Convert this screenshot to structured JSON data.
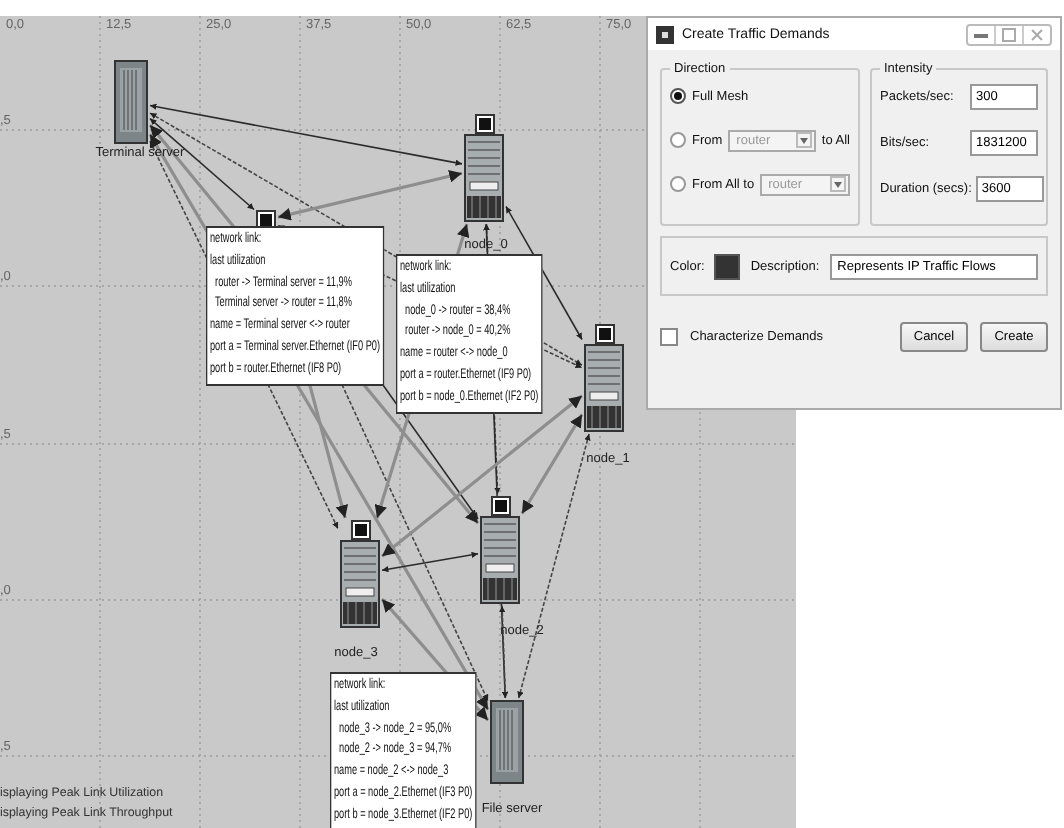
{
  "canvas": {
    "x_axis_labels": [
      "0,0",
      "12,5",
      "25,0",
      "37,5",
      "50,0",
      "62,5",
      "75,0"
    ],
    "y_axis_labels": [
      ",5",
      ",0",
      ",5",
      ",0",
      ",5"
    ],
    "nodes": [
      {
        "kind": "server",
        "label": "Terminal server"
      },
      {
        "kind": "workstation"
      },
      {
        "kind": "router",
        "label": "node_0"
      },
      {
        "kind": "router",
        "label": "node_1"
      },
      {
        "kind": "router",
        "label": "node_2"
      },
      {
        "kind": "router",
        "label": "node_3"
      },
      {
        "kind": "server",
        "label": "File server"
      }
    ],
    "tooltips": [
      {
        "lines": [
          "network link:",
          "last utilization",
          "  router -> Terminal server = 11,9%",
          "  Terminal server -> router = 11,8%",
          "name = Terminal server <-> router",
          "port a = Terminal server.Ethernet (IF0 P0)",
          "port b = router.Ethernet (IF8 P0)"
        ]
      },
      {
        "lines": [
          "network link:",
          "last utilization",
          "  node_0 -> router = 38,4%",
          "  router -> node_0 = 40,2%",
          "name = router <-> node_0",
          "port a = router.Ethernet (IF9 P0)",
          "port b = node_0.Ethernet (IF2 P0)"
        ]
      },
      {
        "lines": [
          "network link:",
          "last utilization",
          "  node_3 -> node_2 = 95,0%",
          "  node_2 -> node_3 = 94,7%",
          "name = node_2 <-> node_3",
          "port a = node_2.Ethernet (IF3 P0)",
          "port b = node_3.Ethernet (IF2 P0)"
        ]
      }
    ],
    "status_lines": [
      "isplaying Peak Link Utilization",
      "isplaying Peak Link Throughput"
    ]
  },
  "dialog": {
    "title": "Create Traffic Demands",
    "direction": {
      "legend": "Direction",
      "options": [
        {
          "label": "Full Mesh",
          "selected": true
        },
        {
          "label": "From",
          "selected": false,
          "dropdown": {
            "value": "router",
            "disabled": true
          },
          "suffix": "to All"
        },
        {
          "label": "From All to",
          "selected": false,
          "dropdown": {
            "value": "router",
            "disabled": true
          }
        }
      ]
    },
    "intensity": {
      "legend": "Intensity",
      "fields": [
        {
          "label": "Packets/sec:",
          "value": "300"
        },
        {
          "label": "Bits/sec:",
          "value": "1831200"
        },
        {
          "label": "Duration (secs):",
          "value": "3600"
        }
      ]
    },
    "color": {
      "label": "Color:",
      "color": "#333333"
    },
    "description": {
      "label": "Description:",
      "value": "Represents IP Traffic Flows"
    },
    "characterize": {
      "label": "Characterize Demands",
      "checked": false
    },
    "buttons": [
      "Cancel",
      "Create"
    ]
  }
}
